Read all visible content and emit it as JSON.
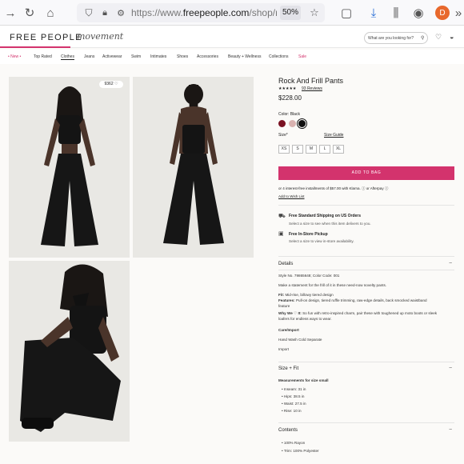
{
  "browser": {
    "url_prefix": "https://www.",
    "url_domain": "freepeople.com",
    "url_path": "/shop/ro",
    "zoom": "50%"
  },
  "site": {
    "logo": "FREE PEOPLE",
    "sub_brand": "movement",
    "search_placeholder": "What are you looking for?"
  },
  "nav": [
    "• New •",
    "Top Rated",
    "Clothes",
    "Jeans",
    "Activewear",
    "Swim",
    "Intimates",
    "Shoes",
    "Accessories",
    "Beauty + Wellness",
    "Collections",
    "Sale"
  ],
  "gallery": {
    "likes": "9362 ♡"
  },
  "product": {
    "title": "Rock And Frill Pants",
    "stars": "★★★★★",
    "reviews": "93 Reviews",
    "price": "$228.00",
    "color_label": "Color: Black",
    "size_label": "Size*",
    "size_guide": "Size Guide",
    "sizes": [
      "XS",
      "S",
      "M",
      "L",
      "XL"
    ],
    "add_to_bag": "ADD TO BAG",
    "installments": "or 4 interest-free installments of $57.00 with Klarna. ⓘ or  Afterpay ⓘ",
    "wishlist": "Add to Wish List",
    "shipping_title": "Free Standard Shipping on US Orders",
    "shipping_text": "Select a size to see when this item delivers to you.",
    "pickup_title": "Free In-Store Pickup",
    "pickup_text": "Select a size to view in-store availability."
  },
  "details": {
    "heading": "Details",
    "style": "Style No. 79865648; Color Code: 001",
    "tagline": "Make a statement for the frill of it in these need-now novelty pants.",
    "fit_label": "Fit:",
    "fit": "Mid-rise, billowy tiered design",
    "features_label": "Features:",
    "features_1": "Pull-on design, tiered ruffle trimming, raw-edge details, back smocked waistband",
    "features_2": "feature",
    "why_label": "Why We ♡ It:",
    "why_1": "So fun with retro-inspired charm, pair these with toughened up moto boots or sleek",
    "why_2": "loafers for endless ways to wear.",
    "care_heading": "Care/Import",
    "care": "Hand Wash Cold Separate",
    "import": "Import"
  },
  "size_fit": {
    "heading": "Size + Fit",
    "measure_title": "Measurements for size small",
    "items": [
      "Inseam: 31 in",
      "Hips: 38.5 in",
      "Waist: 27.5 in",
      "Rise: 10 in"
    ]
  },
  "contents": {
    "heading": "Contents",
    "items": [
      "100% Rayon",
      "Trim: 100% Polyester"
    ]
  },
  "colors": {
    "accent": "#d3336d",
    "swatch_red": "#7a1222",
    "swatch_pink": "#d9b2b0",
    "swatch_black": "#111111"
  }
}
